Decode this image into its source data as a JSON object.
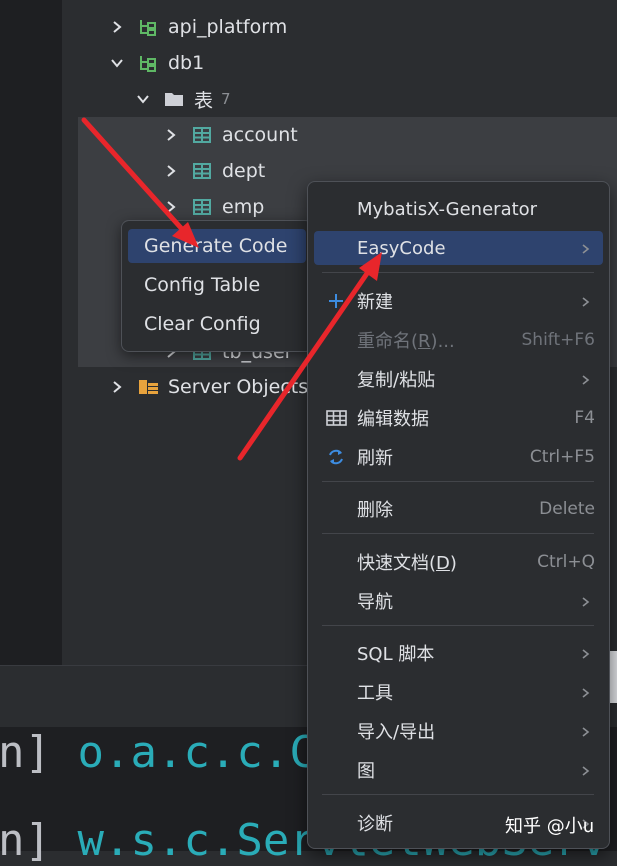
{
  "tree": {
    "items": [
      {
        "label": "api_platform",
        "type": "schema",
        "expanded": false
      },
      {
        "label": "db1",
        "type": "schema",
        "expanded": true
      },
      {
        "label": "表",
        "count": "7",
        "type": "folder",
        "expanded": true
      },
      {
        "label": "account",
        "type": "table",
        "expanded": false
      },
      {
        "label": "dept",
        "type": "table",
        "expanded": false
      },
      {
        "label": "emp",
        "type": "table",
        "expanded": false
      },
      {
        "label": "tb_user",
        "type": "table",
        "expanded": false
      },
      {
        "label": "Server Objects",
        "type": "server-objects",
        "expanded": false
      }
    ]
  },
  "submenu": {
    "items": [
      {
        "label": "Generate Code",
        "active": true
      },
      {
        "label": "Config Table"
      },
      {
        "label": "Clear Config"
      }
    ]
  },
  "context_menu": {
    "items": [
      {
        "label": "MybatisX-Generator"
      },
      {
        "label": "EasyCode",
        "active": true,
        "has_submenu": true
      },
      {
        "label": "新建",
        "icon": "plus-icon",
        "has_submenu": true
      },
      {
        "label_main": "重命名(",
        "label_mnemonic": "R",
        "label_tail": ")...",
        "shortcut": "Shift+F6",
        "disabled": true
      },
      {
        "label": "复制/粘贴",
        "has_submenu": true
      },
      {
        "label": "编辑数据",
        "icon": "table-grid-icon",
        "shortcut": "F4"
      },
      {
        "label": "刷新",
        "icon": "refresh-icon",
        "shortcut": "Ctrl+F5"
      },
      {
        "label": "删除",
        "shortcut": "Delete"
      },
      {
        "label_main": "快速文档(",
        "label_mnemonic": "D",
        "label_tail": ")",
        "shortcut": "Ctrl+Q"
      },
      {
        "label": "导航",
        "has_submenu": true
      },
      {
        "label": "SQL 脚本",
        "has_submenu": true
      },
      {
        "label": "工具",
        "has_submenu": true
      },
      {
        "label": "导入/导出",
        "has_submenu": true
      },
      {
        "label": "图",
        "has_submenu": true
      },
      {
        "label": "诊断",
        "has_submenu": true
      }
    ]
  },
  "console": {
    "line1_prefix": "n] ",
    "line1_text": "o.a.c.c.C",
    "line1_suffix": "[",
    "line2_prefix": "n] ",
    "line2_text": "w.s.c.ServletWebServ"
  },
  "watermark": "知乎 @小u",
  "colors": {
    "accent_active": "#2e436e",
    "annotation_arrow": "#e8262b",
    "table_icon": "#52a9a1",
    "console_cyan": "#2aacb8"
  }
}
